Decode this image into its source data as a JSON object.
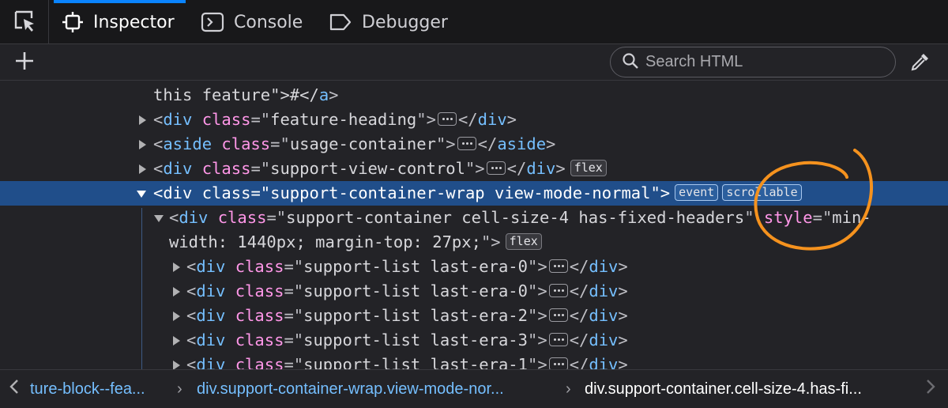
{
  "toolbar": {
    "tabs": [
      {
        "label": "Inspector",
        "selected": true,
        "icon": "inspector-icon"
      },
      {
        "label": "Console",
        "selected": false,
        "icon": "console-icon"
      },
      {
        "label": "Debugger",
        "selected": false,
        "icon": "debugger-icon"
      }
    ],
    "picker_icon": "element-picker-icon"
  },
  "search": {
    "placeholder": "Search HTML",
    "icon": "search-icon"
  },
  "add_icon": "add-node-icon",
  "eyedropper_icon": "eyedropper-icon",
  "markup": {
    "lines": [
      {
        "text_pre": "this feature\">#</",
        "tag_close": "a",
        "end": ">"
      },
      {
        "tag": "div",
        "attr": "class",
        "value": "feature-heading",
        "close": "div"
      },
      {
        "tag": "aside",
        "attr": "class",
        "value": "usage-container",
        "close": "aside"
      },
      {
        "tag": "div",
        "attr": "class",
        "value": "support-view-control",
        "close": "div",
        "badges": [
          "flex"
        ]
      },
      {
        "tag": "div",
        "attr": "class",
        "value": "support-container-wrap view-mode-normal",
        "badges": [
          "event",
          "scrollable"
        ],
        "selected": true
      },
      {
        "tag": "div",
        "attr": "class",
        "value": "support-container cell-size-4 has-fixed-headers",
        "attr2": "style",
        "value2_part1": "min-",
        "value2_part2": "width: 1440px; margin-top: 27px;",
        "badges": [
          "flex"
        ]
      },
      {
        "tag": "div",
        "attr": "class",
        "value": "support-list last-era-0",
        "close": "div"
      },
      {
        "tag": "div",
        "attr": "class",
        "value": "support-list last-era-0",
        "close": "div"
      },
      {
        "tag": "div",
        "attr": "class",
        "value": "support-list last-era-2",
        "close": "div"
      },
      {
        "tag": "div",
        "attr": "class",
        "value": "support-list last-era-3",
        "close": "div"
      },
      {
        "tag": "div",
        "attr": "class",
        "value": "support-list last-era-1",
        "close": "div"
      }
    ]
  },
  "breadcrumbs": {
    "items": [
      {
        "label": "ture-block--fea...",
        "kind": "link"
      },
      {
        "label": "div.support-container-wrap.view-mode-nor...",
        "kind": "link"
      },
      {
        "label": "div.support-container.cell-size-4.has-fi...",
        "kind": "current"
      }
    ],
    "separator": "›"
  },
  "colors": {
    "accent": "#0a84ff",
    "selection": "#204e8a",
    "annotation": "#f5921e",
    "tag": "#75bfff",
    "attr": "#ff97e8"
  }
}
